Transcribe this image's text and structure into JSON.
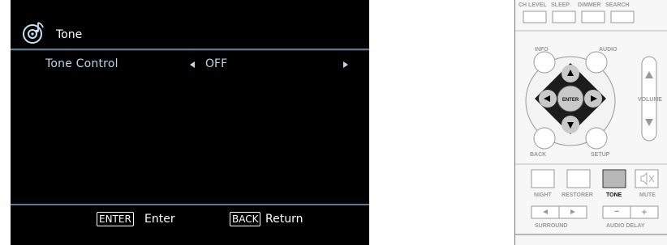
{
  "osd": {
    "title": "Tone",
    "menu_label": "Tone Control",
    "menu_value": "OFF",
    "footer": {
      "enter_key": "ENTER",
      "enter_text": "Enter",
      "back_key": "BACK",
      "back_text": "Return"
    }
  },
  "remote": {
    "top_labels": [
      "CH LEVEL",
      "SLEEP",
      "DIMMER",
      "SEARCH"
    ],
    "info": "INFO",
    "audio": "AUDIO",
    "enter": "ENTER",
    "volume": "VOLUME",
    "back": "BACK",
    "setup": "SETUP",
    "bottom_labels": [
      "NIGHT",
      "RESTORER",
      "TONE",
      "MUTE"
    ],
    "surround": "SURROUND",
    "audio_delay": "AUDIO DELAY",
    "minus": "−",
    "plus": "+"
  },
  "colors": {
    "osd_background": "#000000",
    "osd_text": "#b9d7f0",
    "osd_rule": "#5f7a90",
    "tone_button_highlight": "#b8b8b8"
  },
  "icons": [
    "disc-icon",
    "left-arrow-icon",
    "right-arrow-icon",
    "mute-icon"
  ]
}
